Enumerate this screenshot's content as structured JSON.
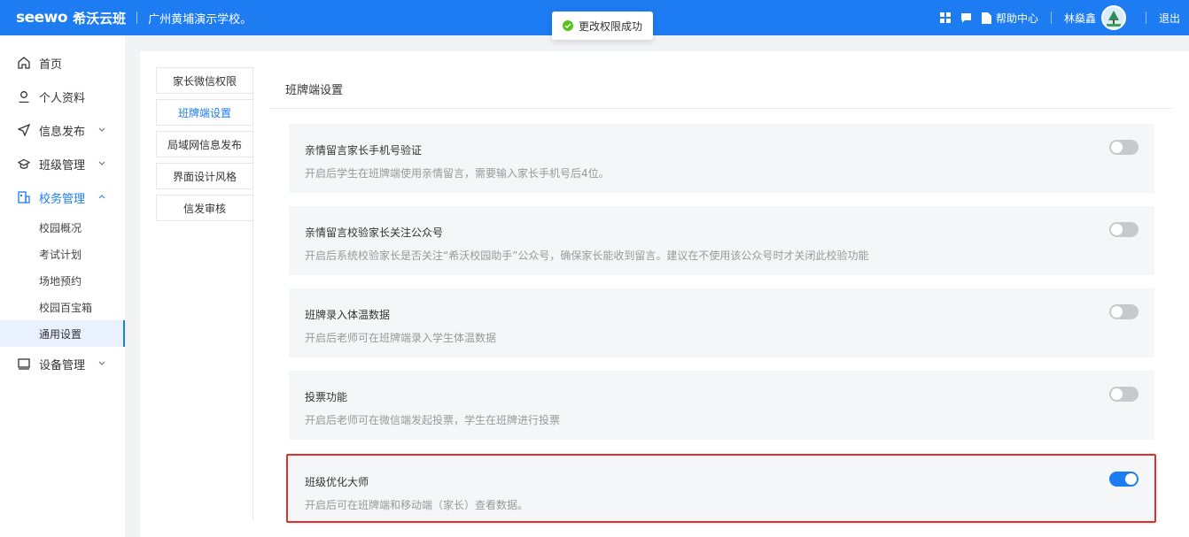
{
  "header": {
    "logo_en": "seewo",
    "logo_cn": "希沃云班",
    "school": "广州黄埔演示学校。",
    "help_label": "帮助中心",
    "user_name": "林燊鑫",
    "logout_label": "退出",
    "icons": [
      "apps-icon",
      "message-icon",
      "document-icon"
    ],
    "brand_color": "#1e7cf2"
  },
  "toast": {
    "message": "更改权限成功"
  },
  "sidebar": {
    "items": [
      {
        "label": "首页",
        "icon": "home-icon"
      },
      {
        "label": "个人资料",
        "icon": "user-icon"
      },
      {
        "label": "信息发布",
        "icon": "send-icon"
      },
      {
        "label": "班级管理",
        "icon": "graduation-icon"
      },
      {
        "label": "校务管理",
        "icon": "office-icon"
      },
      {
        "label": "设备管理",
        "icon": "monitor-icon"
      }
    ],
    "sub_items": [
      "校园概况",
      "考试计划",
      "场地预约",
      "校园百宝箱",
      "通用设置"
    ]
  },
  "tabs": [
    "家长微信权限",
    "班牌端设置",
    "局域网信息发布",
    "界面设计风格",
    "信发审核"
  ],
  "section_title": "班牌端设置",
  "settings": [
    {
      "title": "亲情留言家长手机号验证",
      "desc": "开启后学生在班牌端使用亲情留言，需要输入家长手机号后4位。",
      "enabled": false
    },
    {
      "title": "亲情留言校验家长关注公众号",
      "desc": "开启后系统校验家长是否关注“希沃校园助手”公众号，确保家长能收到留言。建议在不使用该公众号时才关闭此校验功能",
      "enabled": false
    },
    {
      "title": "班牌录入体温数据",
      "desc": "开启后老师可在班牌端录入学生体温数据",
      "enabled": false
    },
    {
      "title": "投票功能",
      "desc": "开启后老师可在微信端发起投票，学生在班牌进行投票",
      "enabled": false
    },
    {
      "title": "班级优化大师",
      "desc": "开启后可在班牌端和移动端（家长）查看数据。",
      "enabled": true
    }
  ]
}
